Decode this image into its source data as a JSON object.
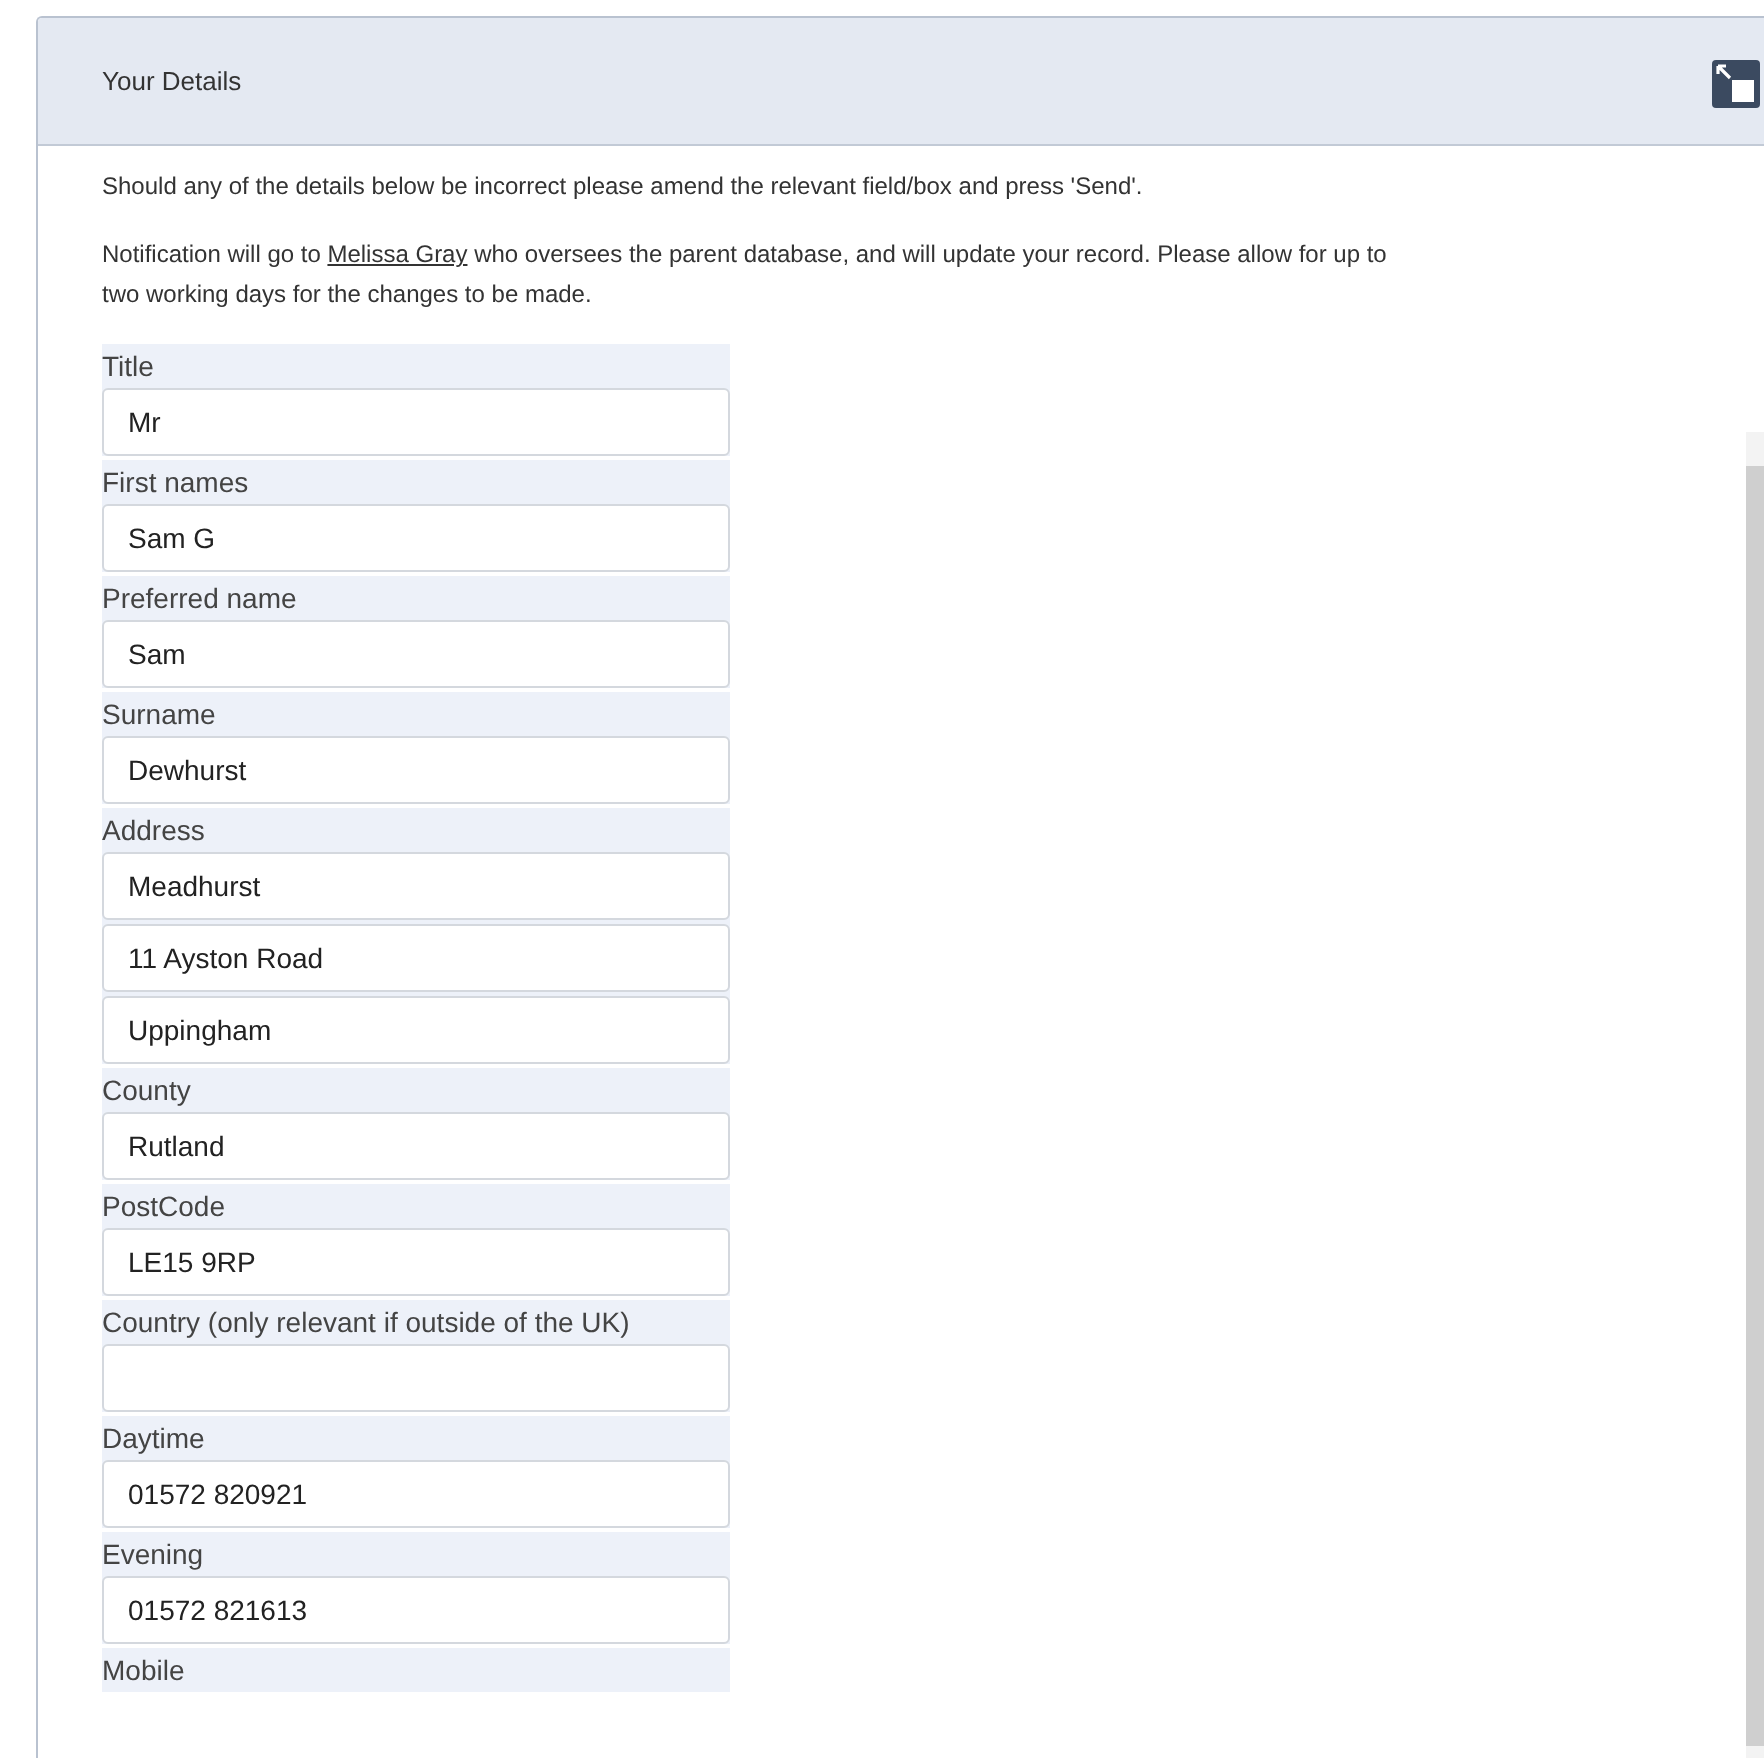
{
  "panel": {
    "title": "Your Details"
  },
  "intro": "Should any of the details below be incorrect please amend the relevant field/box and press 'Send'.",
  "notice": {
    "before": "Notification will go to ",
    "link": "Melissa Gray",
    "after": " who oversees the parent database, and will update your record. Please allow for up to two working days for the changes to be made."
  },
  "fields": [
    {
      "kind": "text",
      "label": "Title",
      "values": [
        "Mr"
      ]
    },
    {
      "kind": "text",
      "label": "First names",
      "values": [
        "Sam G"
      ]
    },
    {
      "kind": "text",
      "label": "Preferred name",
      "values": [
        "Sam"
      ]
    },
    {
      "kind": "text",
      "label": "Surname",
      "values": [
        "Dewhurst"
      ]
    },
    {
      "kind": "text",
      "label": "Address",
      "values": [
        "Meadhurst",
        "11 Ayston Road",
        "Uppingham"
      ]
    },
    {
      "kind": "text",
      "label": "County",
      "values": [
        "Rutland"
      ]
    },
    {
      "kind": "text",
      "label": "PostCode",
      "values": [
        "LE15 9RP"
      ]
    },
    {
      "kind": "blank",
      "label": "Country (only relevant if outside of the UK)"
    },
    {
      "kind": "text",
      "label": "Daytime",
      "values": [
        "01572 820921"
      ]
    },
    {
      "kind": "text",
      "label": "Evening",
      "values": [
        "01572 821613"
      ]
    },
    {
      "kind": "label_only",
      "label": "Mobile"
    }
  ]
}
